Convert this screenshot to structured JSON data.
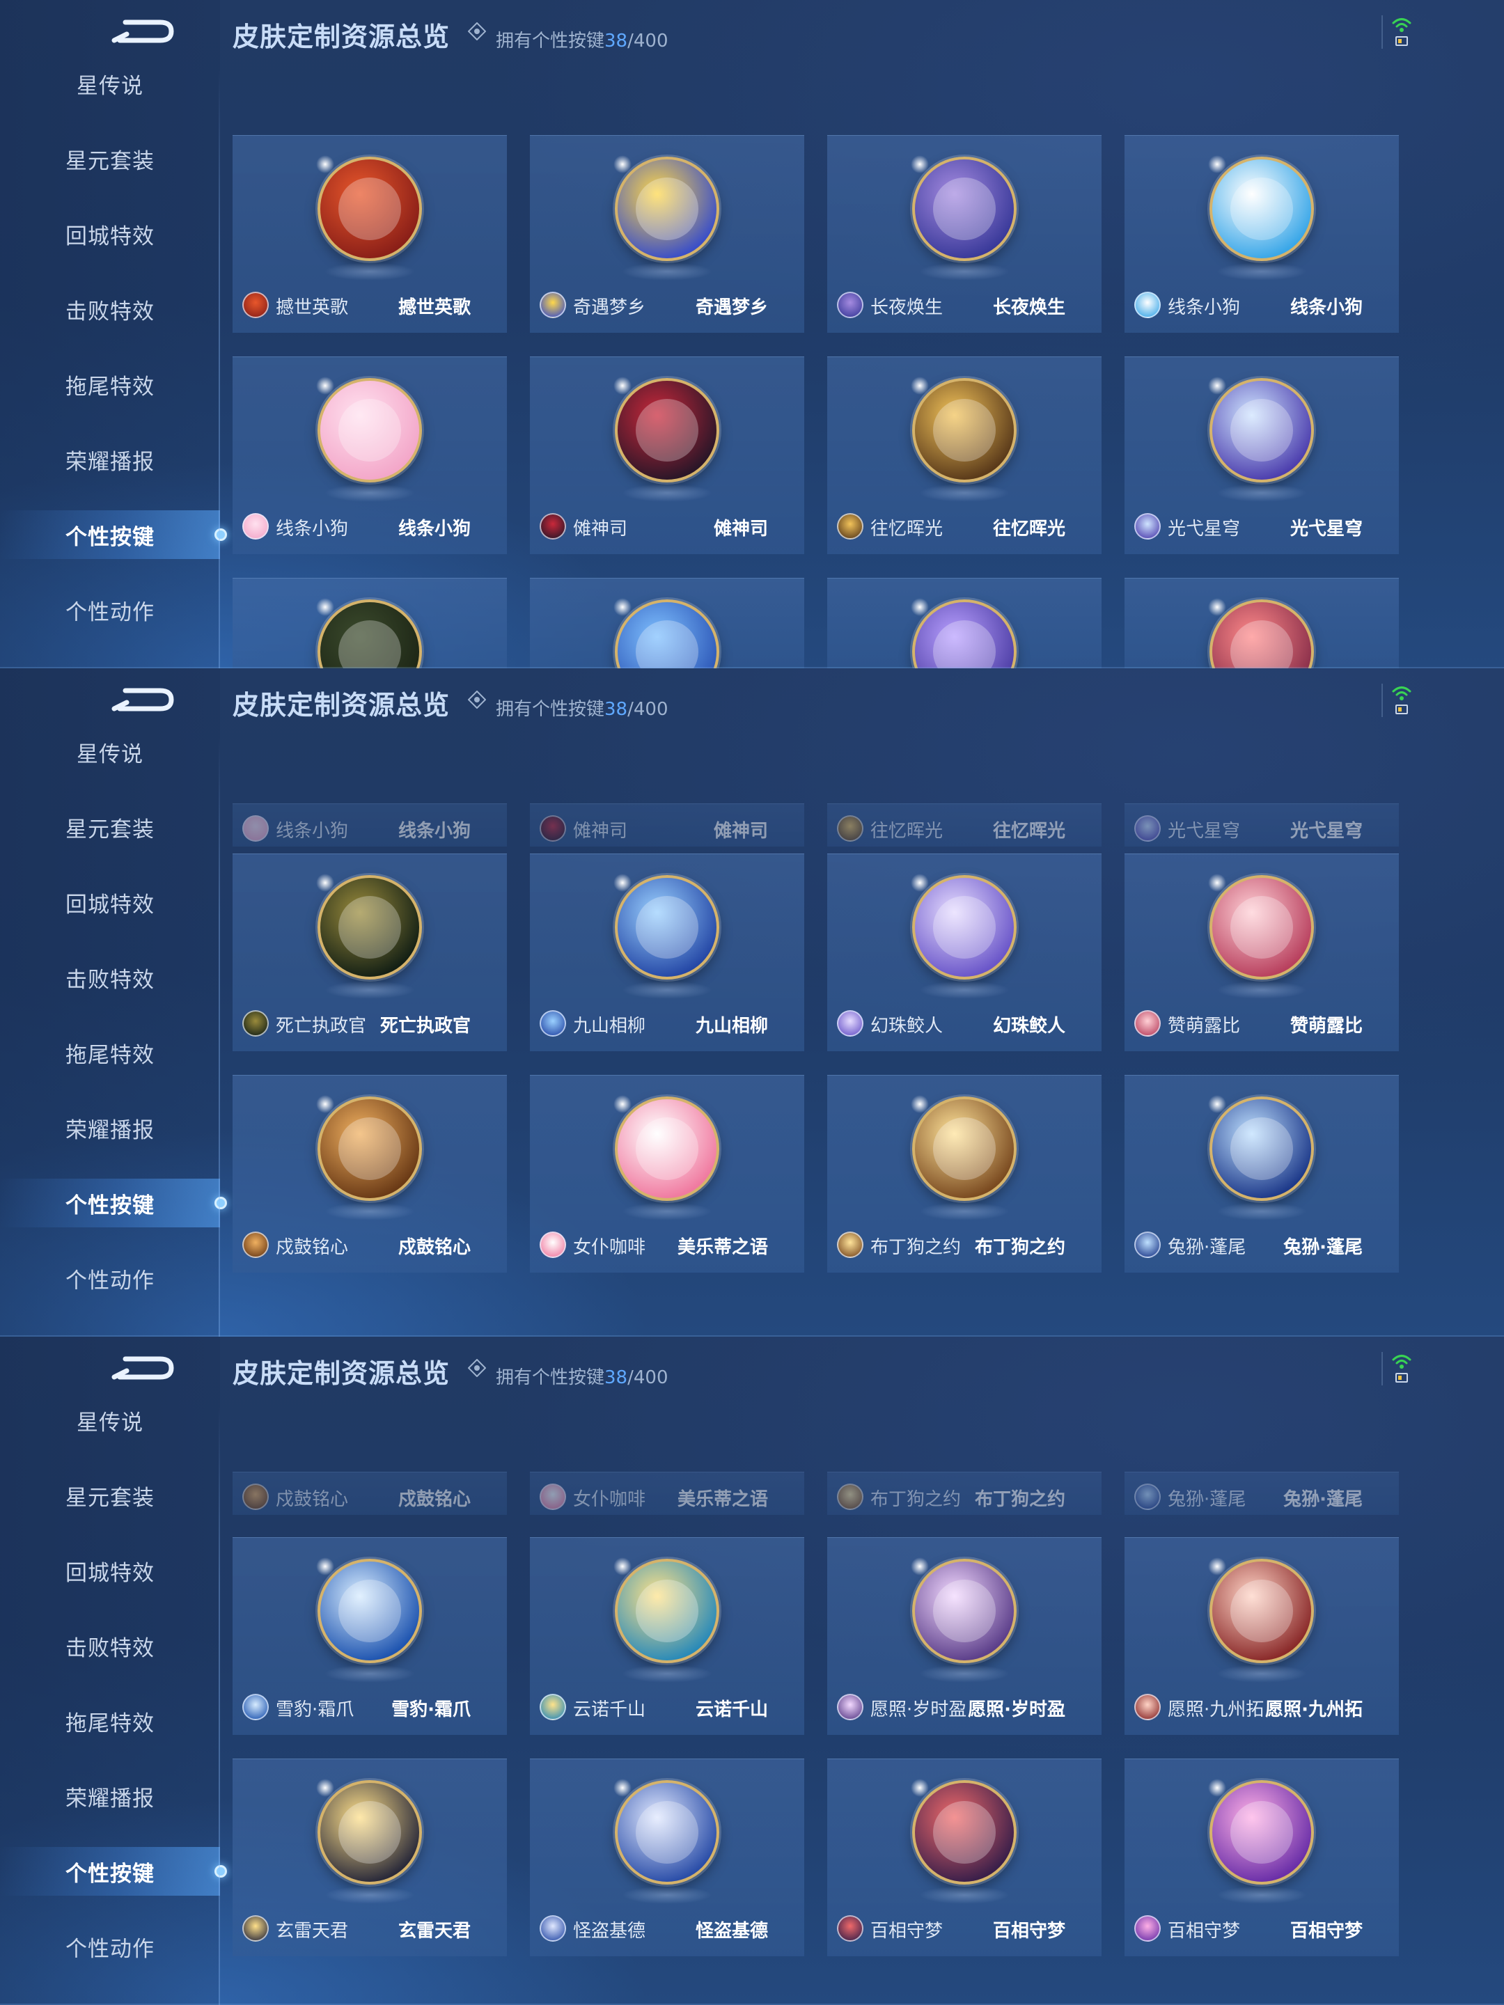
{
  "page": {
    "title": "皮肤定制资源总览",
    "owned_prefix": "拥有个性按键",
    "owned_count": "38",
    "owned_total": "/400"
  },
  "nav": [
    {
      "label": "星传说"
    },
    {
      "label": "星元套装"
    },
    {
      "label": "回城特效"
    },
    {
      "label": "击败特效"
    },
    {
      "label": "拖尾特效"
    },
    {
      "label": "荣耀播报"
    },
    {
      "label": "个性按键",
      "active": true
    },
    {
      "label": "个性动作"
    }
  ],
  "panels": [
    {
      "rows": [
        {
          "style": "full",
          "cards": [
            {
              "hero": "撼世英歌",
              "skin": "撼世英歌",
              "colors": [
                "#e8572b",
                "#8a1f18"
              ]
            },
            {
              "hero": "奇遇梦乡",
              "skin": "奇遇梦乡",
              "colors": [
                "#ffd84a",
                "#3b4fc7"
              ]
            },
            {
              "hero": "长夜焕生",
              "skin": "长夜焕生",
              "colors": [
                "#a58be0",
                "#3a3a9a"
              ]
            },
            {
              "hero": "线条小狗",
              "skin": "线条小狗",
              "colors": [
                "#ffffff",
                "#3aa7e8"
              ]
            }
          ]
        },
        {
          "style": "full",
          "cards": [
            {
              "hero": "线条小狗",
              "skin": "线条小狗",
              "colors": [
                "#ffe1ef",
                "#f3a7c9"
              ]
            },
            {
              "hero": "傩神司",
              "skin": "傩神司",
              "colors": [
                "#c9283a",
                "#2a1628"
              ]
            },
            {
              "hero": "往忆晖光",
              "skin": "往忆晖光",
              "colors": [
                "#f2c35a",
                "#5a3a1a"
              ]
            },
            {
              "hero": "光弋星穹",
              "skin": "光弋星穹",
              "colors": [
                "#cfe4ff",
                "#4d3fae"
              ]
            }
          ]
        },
        {
          "style": "cut",
          "cards": [
            {
              "hero": "",
              "skin": "",
              "colors": [
                "#3b4a2c",
                "#1d2616"
              ]
            },
            {
              "hero": "",
              "skin": "",
              "colors": [
                "#7fc0ff",
                "#2d58b8"
              ]
            },
            {
              "hero": "",
              "skin": "",
              "colors": [
                "#b9a0ff",
                "#4e3fa6"
              ]
            },
            {
              "hero": "",
              "skin": "",
              "colors": [
                "#ff8a8a",
                "#8a2f4a"
              ]
            }
          ]
        }
      ]
    },
    {
      "rows": [
        {
          "style": "compact",
          "cards": [
            {
              "hero": "线条小狗",
              "skin": "线条小狗",
              "colors": [
                "#ffe1ef",
                "#f3a7c9"
              ]
            },
            {
              "hero": "傩神司",
              "skin": "傩神司",
              "colors": [
                "#c9283a",
                "#2a1628"
              ]
            },
            {
              "hero": "往忆晖光",
              "skin": "往忆晖光",
              "colors": [
                "#f2c35a",
                "#5a3a1a"
              ]
            },
            {
              "hero": "光弋星穹",
              "skin": "光弋星穹",
              "colors": [
                "#cfe4ff",
                "#4d3fae"
              ]
            }
          ]
        },
        {
          "style": "full",
          "cards": [
            {
              "hero": "死亡执政官",
              "skin": "死亡执政官",
              "colors": [
                "#9a8b3c",
                "#142015"
              ]
            },
            {
              "hero": "九山相柳",
              "skin": "九山相柳",
              "colors": [
                "#9ad0ff",
                "#2548a6"
              ]
            },
            {
              "hero": "幻珠鲛人",
              "skin": "幻珠鲛人",
              "colors": [
                "#e6dcff",
                "#6a56c9"
              ]
            },
            {
              "hero": "赞萌露比",
              "skin": "赞萌露比",
              "colors": [
                "#ffd0d6",
                "#b8405e"
              ]
            }
          ]
        },
        {
          "style": "full",
          "cards": [
            {
              "hero": "戍鼓铭心",
              "skin": "戍鼓铭心",
              "colors": [
                "#f0b060",
                "#6a3a16"
              ]
            },
            {
              "hero": "女仆咖啡",
              "skin": "美乐蒂之语",
              "colors": [
                "#ffffff",
                "#f07aa0"
              ]
            },
            {
              "hero": "布丁狗之约",
              "skin": "布丁狗之约",
              "colors": [
                "#ffe39a",
                "#7a4a20"
              ]
            },
            {
              "hero": "兔狲·蓬尾",
              "skin": "兔狲·蓬尾",
              "colors": [
                "#bfe0ff",
                "#1e3a8a"
              ]
            }
          ]
        }
      ]
    },
    {
      "rows": [
        {
          "style": "compact",
          "cards": [
            {
              "hero": "戍鼓铭心",
              "skin": "戍鼓铭心",
              "colors": [
                "#f0b060",
                "#6a3a16"
              ]
            },
            {
              "hero": "女仆咖啡",
              "skin": "美乐蒂之语",
              "colors": [
                "#ffffff",
                "#f07aa0"
              ]
            },
            {
              "hero": "布丁狗之约",
              "skin": "布丁狗之约",
              "colors": [
                "#ffe39a",
                "#7a4a20"
              ]
            },
            {
              "hero": "兔狲·蓬尾",
              "skin": "兔狲·蓬尾",
              "colors": [
                "#bfe0ff",
                "#1e3a8a"
              ]
            }
          ]
        },
        {
          "style": "full",
          "cards": [
            {
              "hero": "雪豹·霜爪",
              "skin": "雪豹·霜爪",
              "colors": [
                "#d7ecff",
                "#1f55b0"
              ]
            },
            {
              "hero": "云诺千山",
              "skin": "云诺千山",
              "colors": [
                "#ffe38a",
                "#2a8ab8"
              ]
            },
            {
              "hero": "愿照·岁时盈",
              "skin": "愿照·岁时盈",
              "colors": [
                "#f3d9ff",
                "#5c3f8a"
              ]
            },
            {
              "hero": "愿照·九州拓",
              "skin": "愿照·九州拓",
              "colors": [
                "#ffd4c6",
                "#8a2a2a"
              ]
            }
          ]
        },
        {
          "style": "full",
          "cards": [
            {
              "hero": "玄雷天君",
              "skin": "玄雷天君",
              "colors": [
                "#ffe08a",
                "#2a2a3a"
              ]
            },
            {
              "hero": "怪盗基德",
              "skin": "怪盗基德",
              "colors": [
                "#e0e8ff",
                "#2b4ea8"
              ]
            },
            {
              "hero": "百相守梦",
              "skin": "百相守梦",
              "colors": [
                "#f06a6a",
                "#3a1f4a"
              ]
            },
            {
              "hero": "百相守梦",
              "skin": "百相守梦",
              "colors": [
                "#ffb0e6",
                "#6a2fa8"
              ]
            }
          ]
        }
      ]
    }
  ],
  "icons": {
    "back": "back-arrow-icon",
    "info": "info-icon",
    "wifi": "wifi-icon",
    "battery": "battery-icon"
  },
  "colors": {
    "accent": "#5fa8ff",
    "wifi": "#39d353",
    "battery": "#f0c342"
  }
}
